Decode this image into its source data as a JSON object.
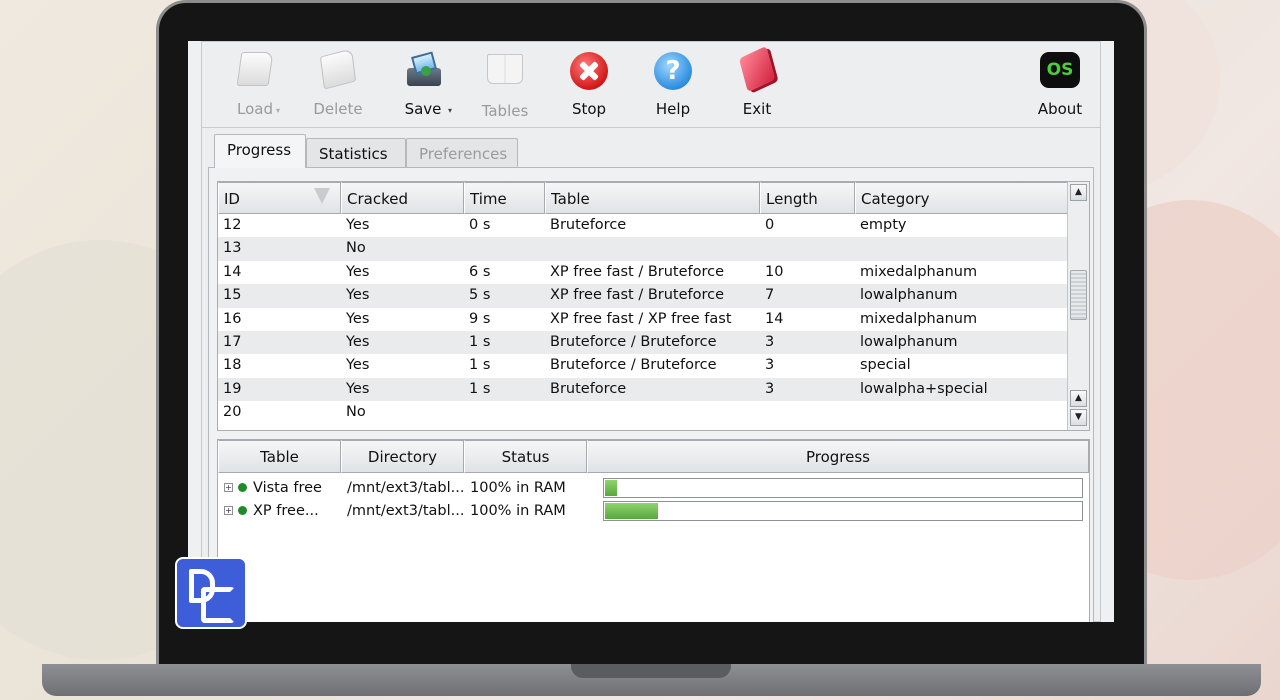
{
  "toolbar": {
    "buttons": [
      {
        "label": "Load",
        "icon": "load-icon",
        "enabled": false
      },
      {
        "label": "Delete",
        "icon": "delete-icon",
        "enabled": false
      },
      {
        "label": "Save",
        "icon": "save-icon",
        "enabled": true
      },
      {
        "label": "Tables",
        "icon": "tables-icon",
        "enabled": false
      },
      {
        "label": "Stop",
        "icon": "stop-icon",
        "enabled": true
      },
      {
        "label": "Help",
        "icon": "help-icon",
        "enabled": true
      },
      {
        "label": "Exit",
        "icon": "exit-icon",
        "enabled": true
      },
      {
        "label": "About",
        "icon": "about-os-icon",
        "enabled": true
      }
    ],
    "about_logo_text": "OS"
  },
  "tabs": [
    {
      "label": "Progress",
      "active": true
    },
    {
      "label": "Statistics",
      "active": false
    },
    {
      "label": "Preferences",
      "active": false,
      "disabled": true
    }
  ],
  "results": {
    "columns": [
      "ID",
      "Cracked",
      "Time",
      "Table",
      "Length",
      "Category"
    ],
    "rows": [
      [
        "12",
        "Yes",
        "0 s",
        "Bruteforce",
        "0",
        "empty"
      ],
      [
        "13",
        "No",
        "",
        "",
        "",
        ""
      ],
      [
        "14",
        "Yes",
        "6 s",
        "XP free fast / Bruteforce",
        "10",
        "mixedalphanum"
      ],
      [
        "15",
        "Yes",
        "5 s",
        "XP free fast / Bruteforce",
        "7",
        "lowalphanum"
      ],
      [
        "16",
        "Yes",
        "9 s",
        "XP free fast / XP free fast",
        "14",
        "mixedalphanum"
      ],
      [
        "17",
        "Yes",
        "1 s",
        "Bruteforce / Bruteforce",
        "3",
        "lowalphanum"
      ],
      [
        "18",
        "Yes",
        "1 s",
        "Bruteforce / Bruteforce",
        "3",
        "special"
      ],
      [
        "19",
        "Yes",
        "1 s",
        "Bruteforce",
        "3",
        "lowalpha+special"
      ],
      [
        "20",
        "No",
        "",
        "",
        "",
        ""
      ]
    ]
  },
  "tables_pane": {
    "columns": [
      "Table",
      "Directory",
      "Status",
      "Progress"
    ],
    "rows": [
      {
        "table": "Vista free",
        "directory": "/mnt/ext3/tabl...",
        "status": "100% in RAM",
        "progress": 0.025
      },
      {
        "table": "XP free...",
        "directory": "/mnt/ext3/tabl...",
        "status": "100% in RAM",
        "progress": 0.11
      }
    ]
  },
  "colors": {
    "progress_fill": "#6cbf4a",
    "accent_stop": "#d21818",
    "accent_help": "#2d8ee0",
    "watermark": "#3d5dd9"
  }
}
